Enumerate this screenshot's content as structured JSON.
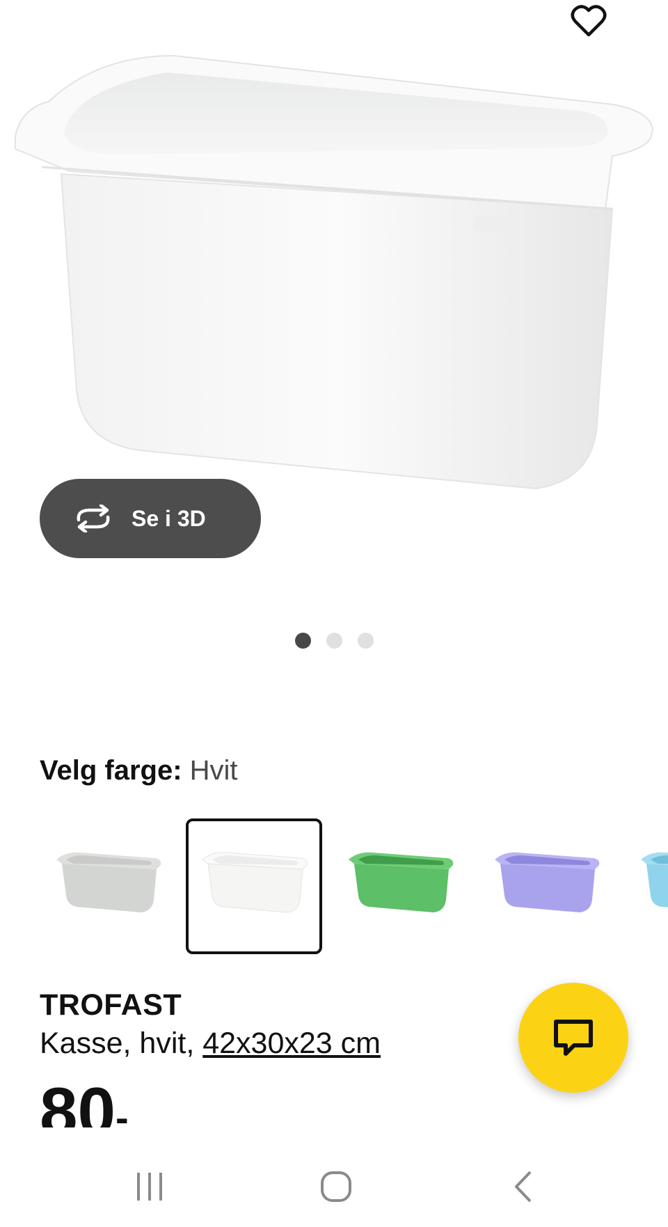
{
  "hero": {
    "view_3d_label": "Se i 3D",
    "carousel_count": 3,
    "carousel_active_index": 0
  },
  "color_selector": {
    "label": "Velg farge:",
    "selected_value": "Hvit",
    "options": [
      {
        "name": "grey",
        "color": "#d6d8d6"
      },
      {
        "name": "white",
        "color": "#f7f7f5"
      },
      {
        "name": "green",
        "color": "#5fbf6a"
      },
      {
        "name": "lilac",
        "color": "#a9a3ee"
      },
      {
        "name": "light-blue",
        "color": "#8fd3ec"
      }
    ],
    "selected_index": 1
  },
  "product": {
    "name": "TROFAST",
    "description_prefix": "Kasse, hvit, ",
    "dimensions": "42x30x23 cm",
    "price": "80",
    "price_suffix": "-"
  },
  "colors": {
    "accent_yellow": "#fcd214",
    "button_dark": "#4d4d4d"
  },
  "icons": [
    "heart-icon",
    "rotate-3d-icon",
    "chat-icon",
    "recent-apps-icon",
    "home-icon",
    "back-icon"
  ]
}
